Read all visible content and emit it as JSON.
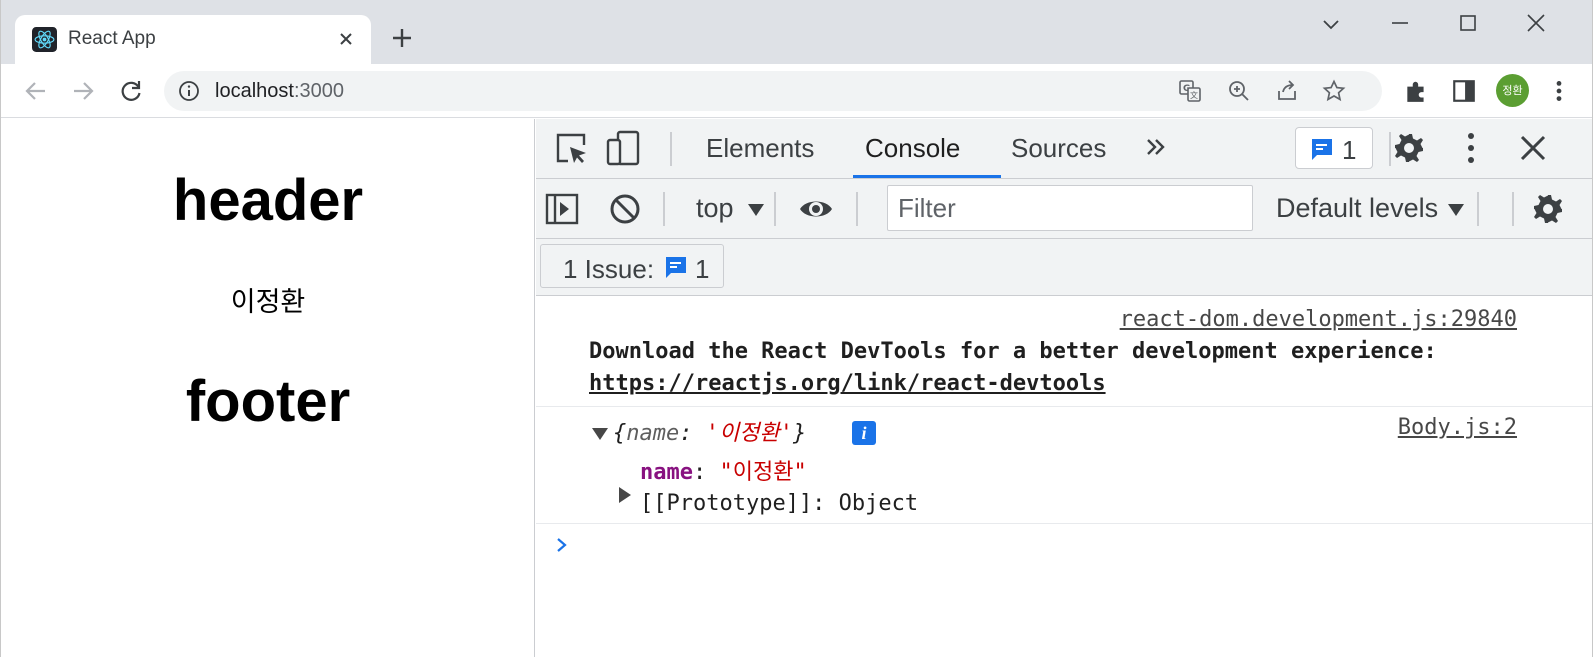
{
  "browser": {
    "tab_title": "React App",
    "url_host": "localhost",
    "url_port": ":3000",
    "profile_initials": "정환",
    "accent_color": "#1a73e8",
    "profile_color": "#5b9e32"
  },
  "page": {
    "header": "header",
    "body_name": "이정환",
    "footer": "footer"
  },
  "devtools": {
    "tabs": [
      {
        "label": "Elements"
      },
      {
        "label": "Console"
      },
      {
        "label": "Sources"
      }
    ],
    "active_tab": "Console",
    "issues_count": "1",
    "context": "top",
    "filter_placeholder": "Filter",
    "levels": "Default levels",
    "issues_label": "1 Issue:",
    "issues_bar_count": "1",
    "console": {
      "msg1": {
        "source": "react-dom.development.js:29840",
        "text": "Download the React DevTools for a better development experience:",
        "link": "https://reactjs.org/link/react-devtools"
      },
      "msg2": {
        "source": "Body.js:2",
        "preview_open": "{",
        "preview_key": "name",
        "preview_sep": ": ",
        "preview_value": "'이정환'",
        "preview_close": "}",
        "info_badge": "i",
        "prop_key": "name",
        "prop_sep": ": ",
        "prop_value": "\"이정환\"",
        "prototype": "[[Prototype]]: Object"
      }
    }
  }
}
